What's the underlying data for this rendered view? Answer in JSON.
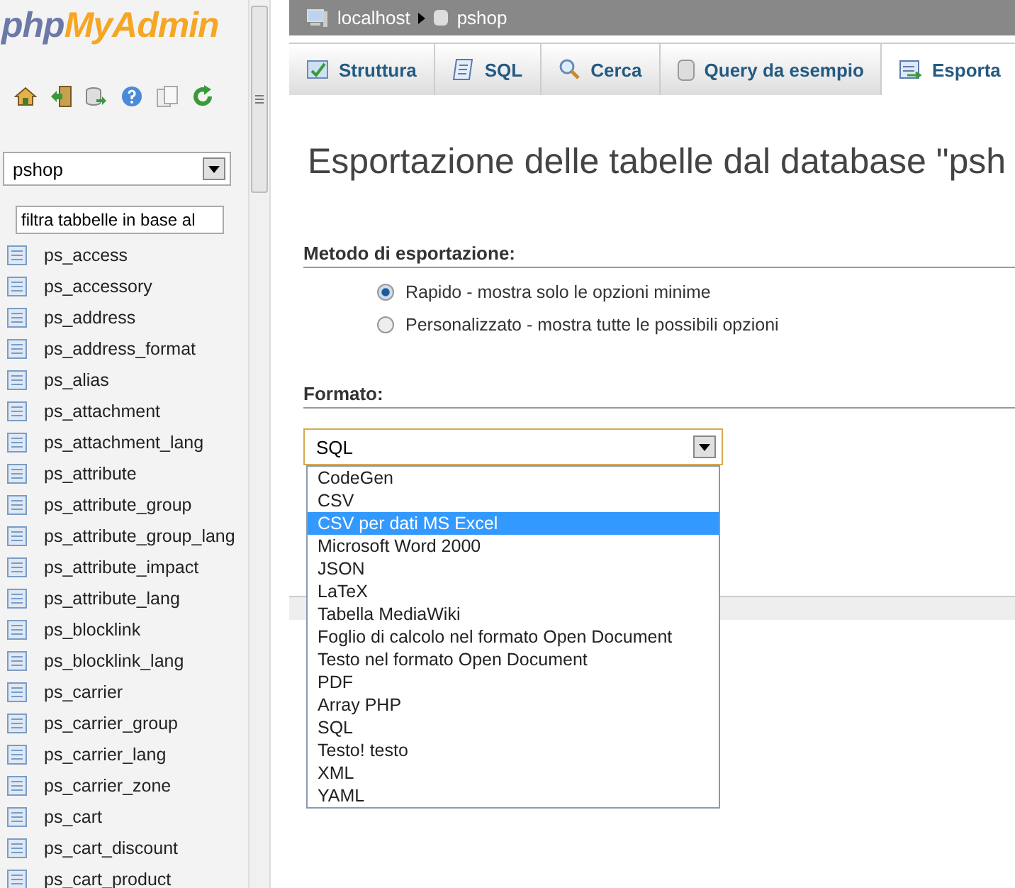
{
  "logo": {
    "first": "php",
    "second": "MyAdmin"
  },
  "sidebar": {
    "database_select": {
      "value": "pshop"
    },
    "filter": {
      "value": "filtra tabbelle in base al"
    },
    "tables": [
      "ps_access",
      "ps_accessory",
      "ps_address",
      "ps_address_format",
      "ps_alias",
      "ps_attachment",
      "ps_attachment_lang",
      "ps_attribute",
      "ps_attribute_group",
      "ps_attribute_group_lang",
      "ps_attribute_impact",
      "ps_attribute_lang",
      "ps_blocklink",
      "ps_blocklink_lang",
      "ps_carrier",
      "ps_carrier_group",
      "ps_carrier_lang",
      "ps_carrier_zone",
      "ps_cart",
      "ps_cart_discount",
      "ps_cart_product"
    ]
  },
  "breadcrumb": [
    "localhost",
    "pshop"
  ],
  "tabs": [
    {
      "label": "Struttura",
      "selected": false,
      "kind": "structure"
    },
    {
      "label": "SQL",
      "selected": false,
      "kind": "sql"
    },
    {
      "label": "Cerca",
      "selected": false,
      "kind": "search"
    },
    {
      "label": "Query da esempio",
      "selected": false,
      "kind": "query"
    },
    {
      "label": "Esporta",
      "selected": true,
      "kind": "export"
    }
  ],
  "title": "Esportazione delle tabelle dal database \"psh",
  "method": {
    "heading": "Metodo di esportazione:",
    "options": [
      {
        "label": "Rapido - mostra solo le opzioni minime",
        "selected": true
      },
      {
        "label": "Personalizzato - mostra tutte le possibili opzioni",
        "selected": false
      }
    ]
  },
  "format": {
    "heading": "Formato:",
    "value": "SQL",
    "options": [
      {
        "label": "CodeGen",
        "highlighted": false
      },
      {
        "label": "CSV",
        "highlighted": false
      },
      {
        "label": "CSV per dati MS Excel",
        "highlighted": true
      },
      {
        "label": "Microsoft Word 2000",
        "highlighted": false
      },
      {
        "label": "JSON",
        "highlighted": false
      },
      {
        "label": "LaTeX",
        "highlighted": false
      },
      {
        "label": "Tabella MediaWiki",
        "highlighted": false
      },
      {
        "label": "Foglio di calcolo nel formato Open Document",
        "highlighted": false
      },
      {
        "label": "Testo nel formato Open Document",
        "highlighted": false
      },
      {
        "label": "PDF",
        "highlighted": false
      },
      {
        "label": "Array PHP",
        "highlighted": false
      },
      {
        "label": "SQL",
        "highlighted": false
      },
      {
        "label": "Testo! testo",
        "highlighted": false
      },
      {
        "label": "XML",
        "highlighted": false
      },
      {
        "label": "YAML",
        "highlighted": false
      }
    ]
  }
}
